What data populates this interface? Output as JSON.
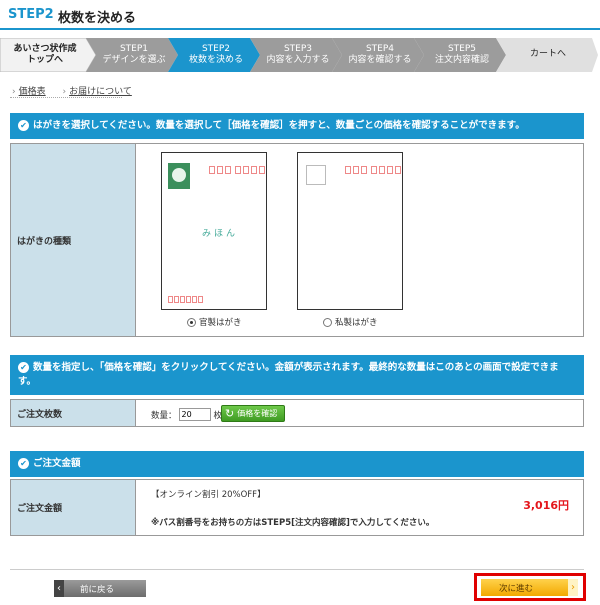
{
  "header": {
    "step": "STEP2",
    "title": "枚数を決める"
  },
  "progress": [
    {
      "line1": "あいさつ状作成",
      "line2": "トップへ"
    },
    {
      "line1": "STEP1",
      "line2": "デザインを選ぶ"
    },
    {
      "line1": "STEP2",
      "line2": "枚数を決める"
    },
    {
      "line1": "STEP3",
      "line2": "内容を入力する"
    },
    {
      "line1": "STEP4",
      "line2": "内容を確認する"
    },
    {
      "line1": "STEP5",
      "line2": "注文内容確認"
    },
    {
      "line1": "カートへ",
      "line2": ""
    }
  ],
  "links": {
    "price_table": "価格表",
    "delivery": "お届けについて"
  },
  "section1": {
    "bar": "はがきを選択してください。数量を選択して［価格を確認］を押すと、数量ごとの価格を確認することができます。",
    "label": "はがきの種類",
    "sample_text": "みほん",
    "options": [
      {
        "label": "官製はがき",
        "selected": true
      },
      {
        "label": "私製はがき",
        "selected": false
      }
    ]
  },
  "section2": {
    "bar": "数量を指定し、「価格を確認」をクリックしてください。金額が表示されます。最終的な数量はこのあとの画面で設定できます。",
    "label": "ご注文枚数",
    "qty_label": "数量：",
    "qty_value": "20",
    "qty_unit": "枚",
    "price_button": "価格を確認"
  },
  "section3": {
    "bar": "ご注文金額",
    "label": "ご注文金額",
    "discount": "【オンライン割引 20%OFF】",
    "price": "3,016円",
    "note": "※パス割番号をお持ちの方はSTEP5[注文内容確認]で入力してください。"
  },
  "footer": {
    "back": "前に戻る",
    "next": "次に進む"
  },
  "colors": {
    "accent": "#1b95cd",
    "price": "#e4161c",
    "next": "#f2a800",
    "highlight": "#e00000"
  }
}
